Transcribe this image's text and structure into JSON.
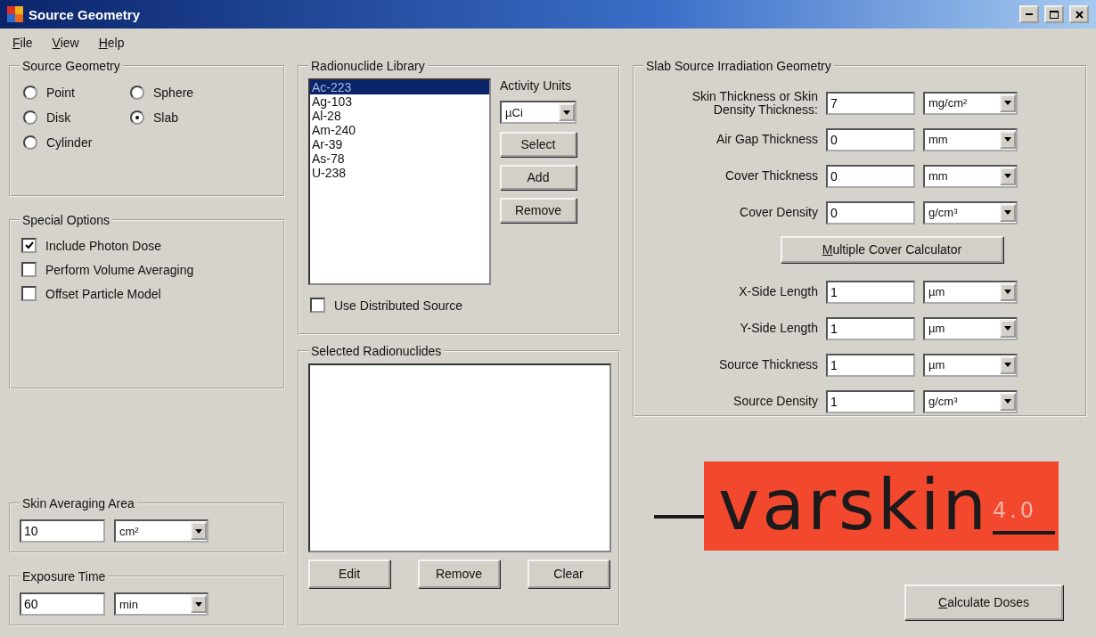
{
  "window": {
    "title": "Source Geometry"
  },
  "menu": [
    {
      "label": "File"
    },
    {
      "label": "View"
    },
    {
      "label": "Help"
    }
  ],
  "source_geometry": {
    "title": "Source Geometry",
    "options": [
      {
        "label": "Point",
        "selected": false
      },
      {
        "label": "Sphere",
        "selected": false
      },
      {
        "label": "Disk",
        "selected": false
      },
      {
        "label": "Slab",
        "selected": true
      },
      {
        "label": "Cylinder",
        "selected": false
      }
    ]
  },
  "special_options": {
    "title": "Special Options",
    "options": [
      {
        "label": "Include Photon Dose",
        "checked": true
      },
      {
        "label": "Perform Volume Averaging",
        "checked": false
      },
      {
        "label": "Offset Particle Model",
        "checked": false
      }
    ]
  },
  "skin_averaging_area": {
    "title": "Skin Averaging Area",
    "value": "10",
    "unit": "cm²"
  },
  "exposure_time": {
    "title": "Exposure Time",
    "value": "60",
    "unit": "min"
  },
  "radionuclide_library": {
    "title": "Radionuclide Library",
    "items": [
      {
        "label": "Ac-223",
        "selected": true
      },
      {
        "label": "Ag-103",
        "selected": false
      },
      {
        "label": "Al-28",
        "selected": false
      },
      {
        "label": "Am-240",
        "selected": false
      },
      {
        "label": "Ar-39",
        "selected": false
      },
      {
        "label": "As-78",
        "selected": false
      },
      {
        "label": "U-238",
        "selected": false
      }
    ],
    "activity_units_label": "Activity Units",
    "activity_units": "µCi",
    "buttons": [
      "Select",
      "Add",
      "Remove"
    ],
    "distributed_source": {
      "label": "Use Distributed Source",
      "checked": false
    }
  },
  "selected_radionuclides": {
    "title": "Selected Radionuclides",
    "buttons": [
      "Edit",
      "Remove",
      "Clear"
    ]
  },
  "slab_geometry": {
    "title": "Slab Source Irradiation Geometry",
    "rows": [
      {
        "kind": "field",
        "label": "Skin Thickness or Skin Density Thickness:",
        "value": "7",
        "unit": "mg/cm²"
      },
      {
        "kind": "field",
        "label": "Air Gap Thickness",
        "value": "0",
        "unit": "mm"
      },
      {
        "kind": "field",
        "label": "Cover Thickness",
        "value": "0",
        "unit": "mm"
      },
      {
        "kind": "field",
        "label": "Cover Density",
        "value": "0",
        "unit": "g/cm³"
      },
      {
        "kind": "button",
        "label": "Multiple Cover Calculator"
      },
      {
        "kind": "field",
        "label": "X-Side Length",
        "value": "1",
        "unit": "µm"
      },
      {
        "kind": "field",
        "label": "Y-Side Length",
        "value": "1",
        "unit": "µm"
      },
      {
        "kind": "field",
        "label": "Source Thickness",
        "value": "1",
        "unit": "µm"
      },
      {
        "kind": "field",
        "label": "Source Density",
        "value": "1",
        "unit": "g/cm³"
      }
    ]
  },
  "logo": {
    "name": "varskin",
    "version": "4.0"
  },
  "calculate_button": {
    "label": "Calculate Doses"
  }
}
